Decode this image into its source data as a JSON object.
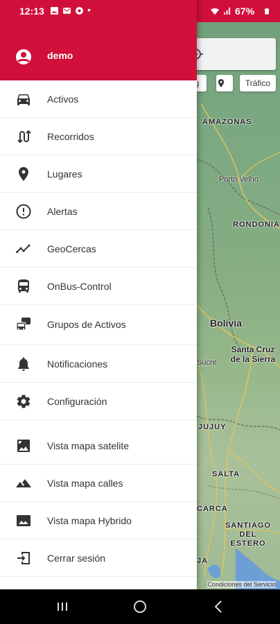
{
  "status_bar": {
    "time": "12:13",
    "dot": "•",
    "battery": "67%"
  },
  "user": {
    "name": "demo"
  },
  "menu": [
    {
      "label": "Activos",
      "icon": "car-icon"
    },
    {
      "label": "Recorridos",
      "icon": "route-icon"
    },
    {
      "label": "Lugares",
      "icon": "place-pin-icon"
    },
    {
      "label": "Alertas",
      "icon": "alert-circle-icon"
    },
    {
      "label": "GeoCercas",
      "icon": "timeline-icon"
    },
    {
      "label": "OnBus-Control",
      "icon": "bus-icon"
    },
    {
      "label": "Grupos de Activos",
      "icon": "vehicle-group-icon"
    },
    {
      "label": "Notificaciones",
      "icon": "bell-icon"
    },
    {
      "label": "Configuración",
      "icon": "gear-icon"
    },
    {
      "label": "Vista mapa satelite",
      "icon": "satellite-image-icon"
    },
    {
      "label": "Vista mapa calles",
      "icon": "terrain-icon"
    },
    {
      "label": "Vista mapa Hybrido",
      "icon": "image-icon"
    },
    {
      "label": "Cerrar sesión",
      "icon": "logout-icon"
    }
  ],
  "map": {
    "traffic_label": "Tráfico",
    "chip_partial": "g",
    "labels": {
      "amazonas": "AMAZONAS",
      "porto_velho": "Porto Velho",
      "rondonia": "RONDONIA",
      "bolivia": "Bolivia",
      "santa_cruz": "Santa Cruz de la Sierra",
      "sucre": "Sucre",
      "jujuy": "JUJUY",
      "salta": "SALTA",
      "tucuman": "CARCA",
      "santiago": "SANTIAGO DEL ESTERO",
      "rioja": "JA"
    },
    "attribution": "Condiciones del Servicio"
  },
  "colors": {
    "brand_red": "#d0103a",
    "icon_gray": "#333333"
  }
}
